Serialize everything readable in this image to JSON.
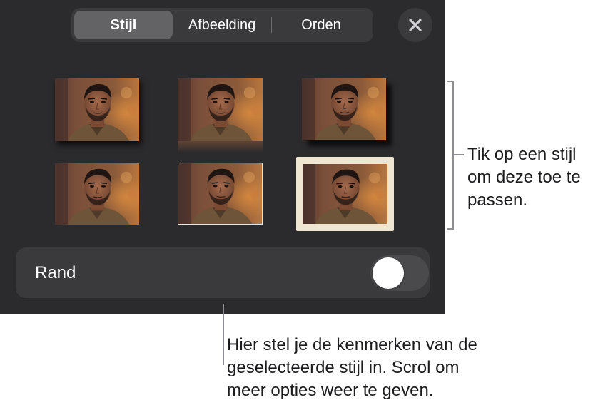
{
  "tabs": [
    {
      "label": "Stijl",
      "active": true
    },
    {
      "label": "Afbeelding",
      "active": false
    },
    {
      "label": "Orden",
      "active": false
    }
  ],
  "close_icon": "close-icon",
  "styles": [
    {
      "name": "Schaduw"
    },
    {
      "name": "Reflectie"
    },
    {
      "name": "Schaduw rechts"
    },
    {
      "name": "Eenvoudig"
    },
    {
      "name": "Dunne rand"
    },
    {
      "name": "Fotorand"
    }
  ],
  "border_row": {
    "label": "Rand",
    "toggle_on": false
  },
  "callouts": {
    "right": "Tik op een stijl\nom deze toe te\npassen.",
    "bottom": "Hier stel je de kenmerken van de\ngeselecteerde stijl in. Scrol om\nmeer opties weer te geven."
  },
  "colors": {
    "panel_bg": "#2b2b2d",
    "control_bg": "#3a3a3c",
    "active_segment": "#636366",
    "leader_line": "#8e8e93"
  }
}
